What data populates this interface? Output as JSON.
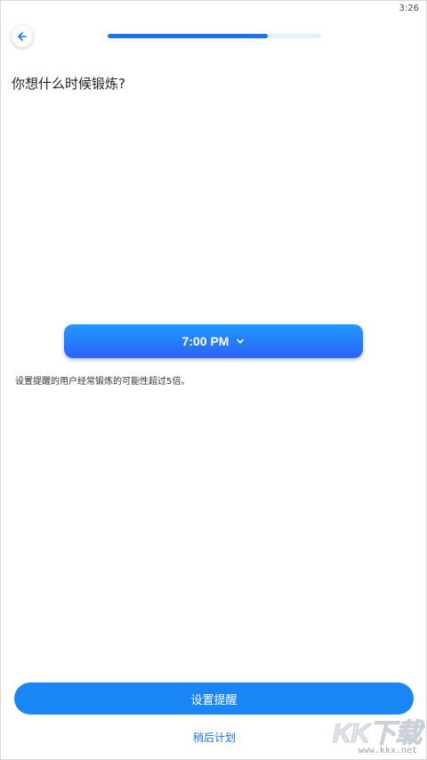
{
  "status_bar": {
    "time": "3:26"
  },
  "header": {
    "back_icon": "arrow-left-icon",
    "progress_percent": 75
  },
  "main": {
    "title": "你想什么时候锻炼?",
    "time_picker": {
      "value": "7:00 PM",
      "icon": "chevron-down-icon"
    },
    "hint": "设置提醒的用户经常锻炼的可能性超过5倍。"
  },
  "actions": {
    "set_reminder_label": "设置提醒",
    "later_label": "稍后计划"
  },
  "watermark": {
    "logo_text": "KK下载",
    "site": "www.kkx.net"
  },
  "colors": {
    "accent": "#1a73e8",
    "button": "#1a86f5",
    "picker_top": "#1f9bff",
    "picker_bottom": "#2c62f5",
    "progress_track": "#e6eef9"
  }
}
